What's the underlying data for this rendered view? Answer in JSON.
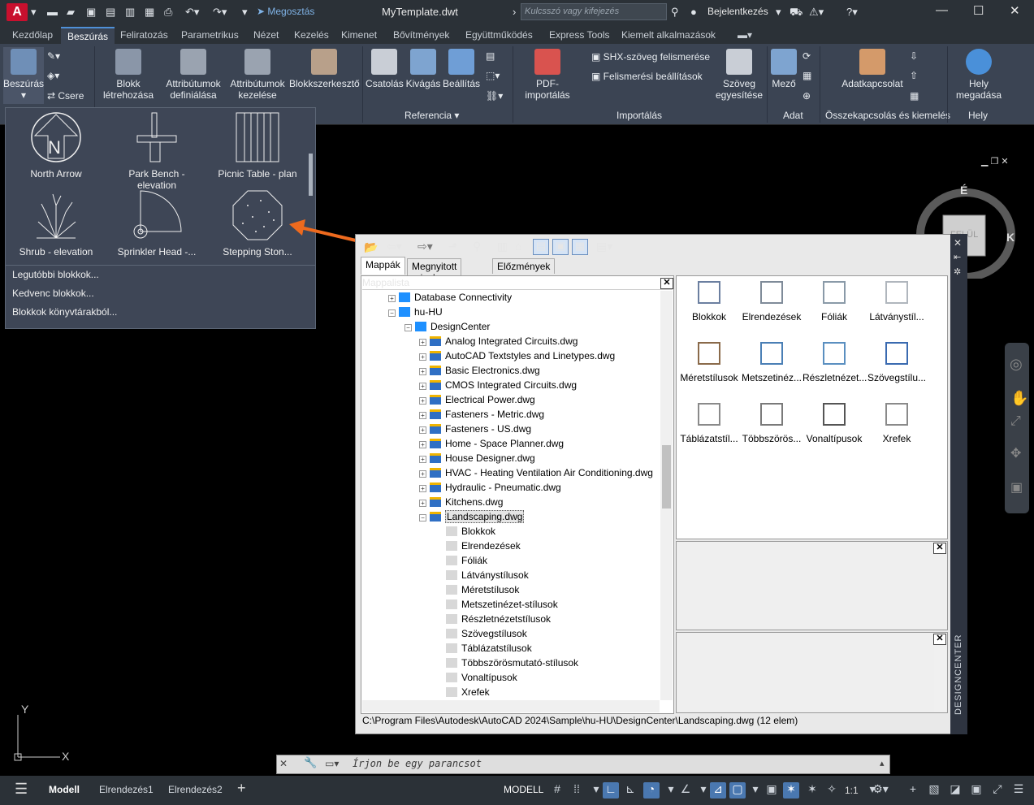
{
  "titlebar": {
    "share": "Megosztás",
    "title": "MyTemplate.dwt",
    "search_placeholder": "Kulcsszó vagy kifejezés",
    "login": "Bejelentkezés"
  },
  "tabs": [
    "Kezdőlap",
    "Beszúrás",
    "Feliratozás",
    "Parametrikus",
    "Nézet",
    "Kezelés",
    "Kimenet",
    "Bővítmények",
    "Együttműködés",
    "Express Tools",
    "Kiemelt alkalmazások"
  ],
  "ribbon": {
    "insert": "Beszúrás",
    "replace": "Csere",
    "block_create": "Blokk\nlétrehozása",
    "attr_define": "Attribútumok\ndefiniálása",
    "attr_manage": "Attribútumok\nkezelése",
    "block_editor": "Blokkszerkesztő",
    "attach": "Csatolás",
    "clip": "Kivágás",
    "settings": "Beállítás",
    "ref_label": "Referencia",
    "pdf_import": "PDF-\nimportálás",
    "shx": "SHX-szöveg felismerése",
    "recog_settings": "Felismerési beállítások",
    "import_label": "Importálás",
    "text_unify": "Szöveg\negyesítése",
    "field": "Mező",
    "data_label": "Adat",
    "data_link": "Adatkapcsolat",
    "link_label": "Összekapcsolás és kiemelés",
    "location": "Hely\nmegadása",
    "location_label": "Hely"
  },
  "gallery": {
    "items": [
      "North Arrow",
      "Park Bench - elevation",
      "Picnic Table - plan",
      "Shrub - elevation",
      "Sprinkler Head -...",
      "Stepping Ston..."
    ],
    "menu": [
      "Legutóbbi blokkok...",
      "Kedvenc blokkok...",
      "Blokkok könyvtárakból..."
    ]
  },
  "designcenter": {
    "tabs": [
      "Mappák",
      "Megnyitott rajzok",
      "Előzmények"
    ],
    "tree_header": "Mappalista",
    "tree": [
      {
        "label": "Database Connectivity",
        "indent": 0
      },
      {
        "label": "hu-HU",
        "indent": 0
      },
      {
        "label": "DesignCenter",
        "indent": 1
      },
      {
        "label": "Analog Integrated Circuits.dwg",
        "indent": 2
      },
      {
        "label": "AutoCAD Textstyles and Linetypes.dwg",
        "indent": 2
      },
      {
        "label": "Basic Electronics.dwg",
        "indent": 2
      },
      {
        "label": "CMOS Integrated Circuits.dwg",
        "indent": 2
      },
      {
        "label": "Electrical Power.dwg",
        "indent": 2
      },
      {
        "label": "Fasteners - Metric.dwg",
        "indent": 2
      },
      {
        "label": "Fasteners - US.dwg",
        "indent": 2
      },
      {
        "label": "Home - Space Planner.dwg",
        "indent": 2
      },
      {
        "label": "House Designer.dwg",
        "indent": 2
      },
      {
        "label": "HVAC - Heating Ventilation Air Conditioning.dwg",
        "indent": 2
      },
      {
        "label": "Hydraulic - Pneumatic.dwg",
        "indent": 2
      },
      {
        "label": "Kitchens.dwg",
        "indent": 2
      },
      {
        "label": "Landscaping.dwg",
        "indent": 2
      },
      {
        "label": "Blokkok",
        "indent": 3
      },
      {
        "label": "Elrendezések",
        "indent": 3
      },
      {
        "label": "Fóliák",
        "indent": 3
      },
      {
        "label": "Látványstílusok",
        "indent": 3
      },
      {
        "label": "Méretstílusok",
        "indent": 3
      },
      {
        "label": "Metszetinézet-stílusok",
        "indent": 3
      },
      {
        "label": "Részletnézetstílusok",
        "indent": 3
      },
      {
        "label": "Szövegstílusok",
        "indent": 3
      },
      {
        "label": "Táblázatstílusok",
        "indent": 3
      },
      {
        "label": "Többszörösmutató-stílusok",
        "indent": 3
      },
      {
        "label": "Vonaltípusok",
        "indent": 3
      },
      {
        "label": "Xrefek",
        "indent": 3
      }
    ],
    "icons": [
      "Blokkok",
      "Elrendezések",
      "Fóliák",
      "Látványstíl...",
      "Méretstílusok",
      "Metszetinéz...",
      "Részletnézet...",
      "Szövegstílu...",
      "Táblázatstíl...",
      "Többszörös...",
      "Vonaltípusok",
      "Xrefek"
    ],
    "status": "C:\\Program Files\\Autodesk\\AutoCAD 2024\\Sample\\hu-HU\\DesignCenter\\Landscaping.dwg (12 elem)",
    "side_label": "DESIGNCENTER"
  },
  "viewcube": {
    "north": "É",
    "east": "K",
    "face": "FELÜL"
  },
  "command": {
    "placeholder": "Írjon be egy parancsot"
  },
  "layout_tabs": [
    "Modell",
    "Elrendezés1",
    "Elrendezés2"
  ],
  "status_bar": {
    "model": "MODELL",
    "scale": "1:1"
  }
}
